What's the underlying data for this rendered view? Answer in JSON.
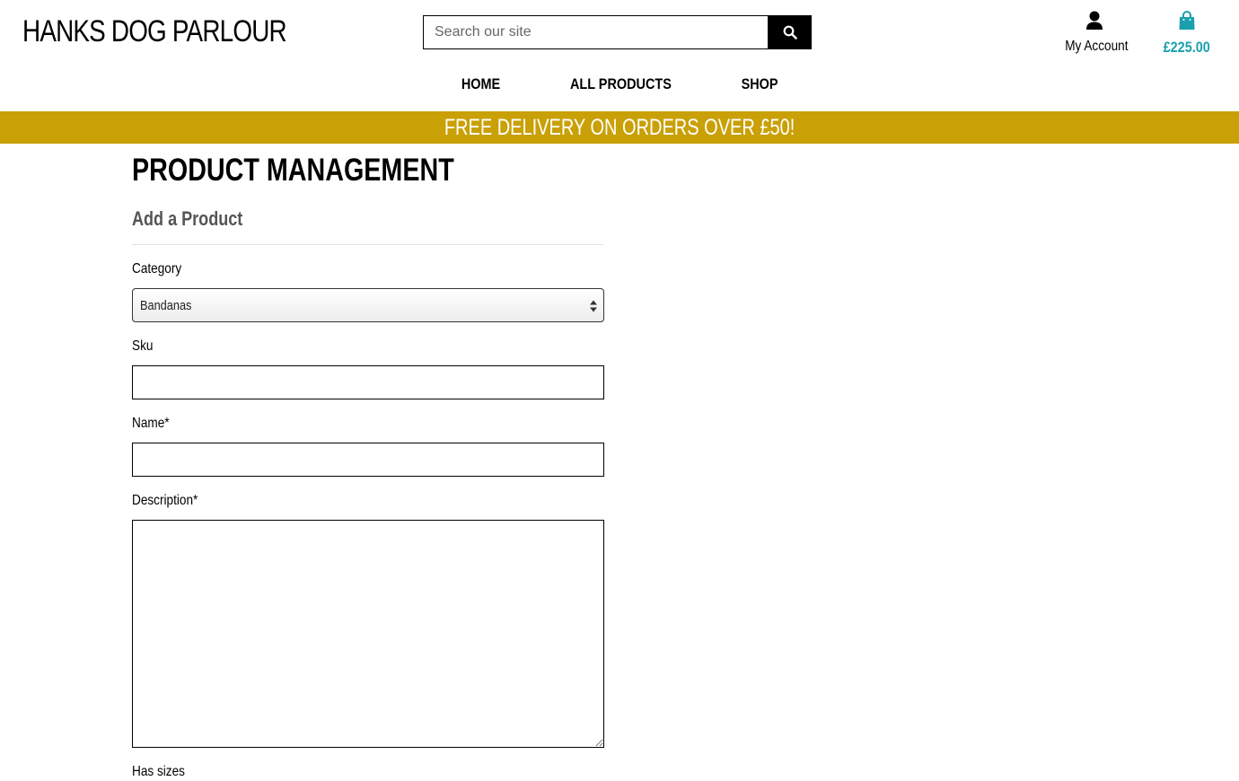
{
  "header": {
    "brand": "HANKS DOG PARLOUR",
    "search": {
      "placeholder": "Search our site",
      "button_icon": "search-icon"
    },
    "account": {
      "label": "My Account",
      "icon": "user-icon"
    },
    "bag": {
      "total": "£225.00",
      "icon": "shopping-bag-icon"
    }
  },
  "nav": {
    "items": [
      {
        "label": "HOME"
      },
      {
        "label": "ALL PRODUCTS"
      },
      {
        "label": "SHOP"
      }
    ]
  },
  "banner": {
    "text": "FREE DELIVERY ON ORDERS OVER £50!"
  },
  "main": {
    "title": "PRODUCT MANAGEMENT",
    "subtitle": "Add a Product",
    "form": {
      "category": {
        "label": "Category",
        "value": "Bandanas"
      },
      "sku": {
        "label": "Sku",
        "value": ""
      },
      "name": {
        "label": "Name*",
        "value": ""
      },
      "description": {
        "label": "Description*",
        "value": ""
      },
      "has_sizes": {
        "label": "Has sizes"
      }
    }
  },
  "colors": {
    "banner": "#c9a005",
    "bag_accent": "#1aa0ad",
    "search_button": "#000000"
  }
}
